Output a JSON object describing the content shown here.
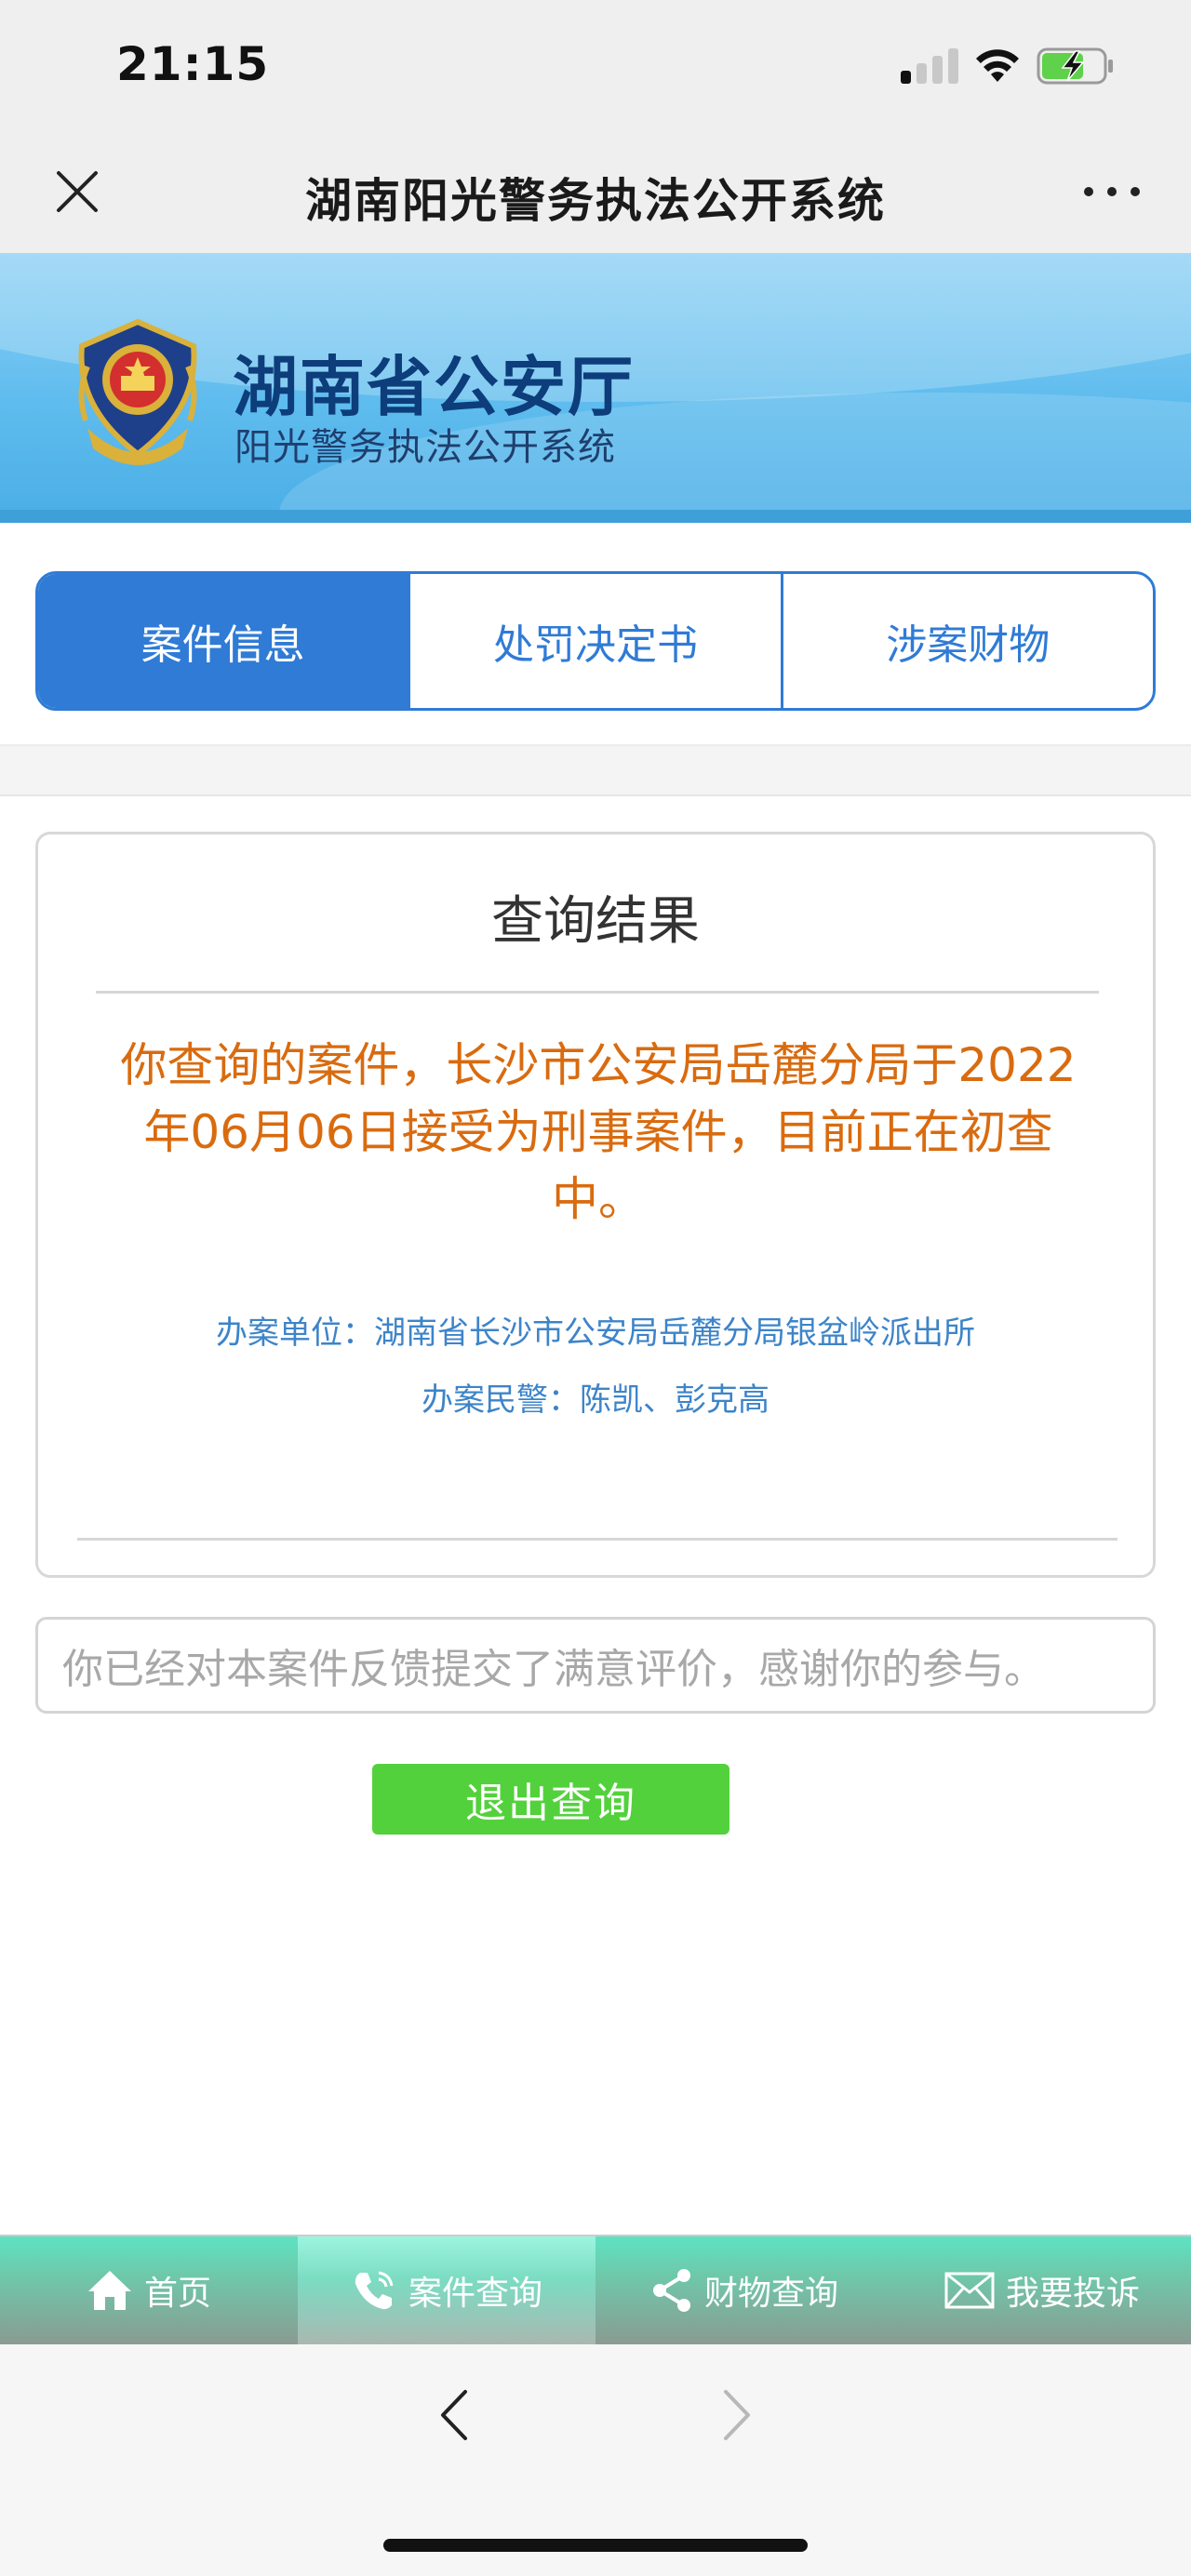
{
  "status_bar": {
    "time": "21:15",
    "icons": [
      "signal-icon",
      "wifi-icon",
      "battery-charging-icon"
    ]
  },
  "nav_bar": {
    "title": "湖南阳光警务执法公开系统",
    "close_icon": "close-icon",
    "more_icon": "more-icon"
  },
  "banner": {
    "title": "湖南省公安厅",
    "subtitle": "阳光警务执法公开系统",
    "emblem_icon": "police-emblem-icon"
  },
  "tabs": [
    {
      "label": "案件信息",
      "active": true
    },
    {
      "label": "处罚决定书",
      "active": false
    },
    {
      "label": "涉案财物",
      "active": false
    }
  ],
  "result": {
    "title": "查询结果",
    "message_line1": "你查询的案件，长沙市公安局岳麓分局于2022",
    "message_line2": "年06月06日接受为刑事案件，目前正在初查",
    "message_line3": "中。",
    "unit": "办案单位：湖南省长沙市公安局岳麓分局银盆岭派出所",
    "police": "办案民警：陈凯、彭克高"
  },
  "feedback": {
    "text": "你已经对本案件反馈提交了满意评价，感谢你的参与。"
  },
  "exit_button": {
    "label": "退出查询"
  },
  "bottom_nav": [
    {
      "label": "首页",
      "icon": "home-icon",
      "active": false
    },
    {
      "label": "案件查询",
      "icon": "phone-icon",
      "active": true
    },
    {
      "label": "财物查询",
      "icon": "share-icon",
      "active": false
    },
    {
      "label": "我要投诉",
      "icon": "mail-icon",
      "active": false
    }
  ],
  "colors": {
    "primary_blue": "#2f7bd6",
    "message_orange": "#d96b0f",
    "info_blue": "#3d84c9",
    "exit_green": "#53d13c"
  }
}
